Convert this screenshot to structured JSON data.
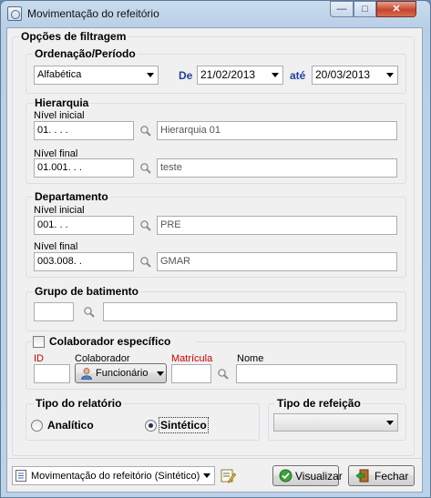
{
  "window": {
    "title": "Movimentação do refeitório",
    "minimize_glyph": "—",
    "maximize_glyph": "□",
    "close_glyph": "✕"
  },
  "filter": {
    "title": "Opções de filtragem",
    "ordering": {
      "title": "Ordenação/Período",
      "order_value": "Alfabética",
      "from_label": "De",
      "from_date": "21/02/2013",
      "to_label": "até",
      "to_date": "20/03/2013"
    },
    "hierarchy": {
      "title": "Hierarquia",
      "initial_label": "Nível inicial",
      "initial_code": "01.   .   .   .",
      "initial_desc": "Hierarquia 01",
      "final_label": "Nível final",
      "final_code": "01.001.   .   .",
      "final_desc": "teste"
    },
    "department": {
      "title": "Departamento",
      "initial_label": "Nível inicial",
      "initial_code": "001.   .   .",
      "initial_desc": "PRE",
      "final_label": "Nível final",
      "final_code": "003.008.   .",
      "final_desc": "GMAR"
    },
    "batch_group": {
      "title": "Grupo de batimento",
      "code": "",
      "desc": ""
    },
    "employee": {
      "title": "Colaborador específico",
      "checked": false,
      "id_label": "ID",
      "collab_label": "Colaborador",
      "collab_type": "Funcionário",
      "matricula_label": "Matrícula",
      "name_label": "Nome",
      "id_value": "",
      "matricula_value": "",
      "name_value": ""
    },
    "report_type": {
      "title": "Tipo do relatório",
      "analytic_label": "Analítico",
      "synthetic_label": "Sintético",
      "selected": "Sintético"
    },
    "meal_type": {
      "title": "Tipo de refeição",
      "value": ""
    }
  },
  "footer": {
    "report_select": "Movimentação do refeitório (Sintético)",
    "view_button": "Visualizar",
    "close_button": "Fechar"
  },
  "colors": {
    "accent_blue": "#1f3f9c",
    "required_red": "#cc0000"
  }
}
